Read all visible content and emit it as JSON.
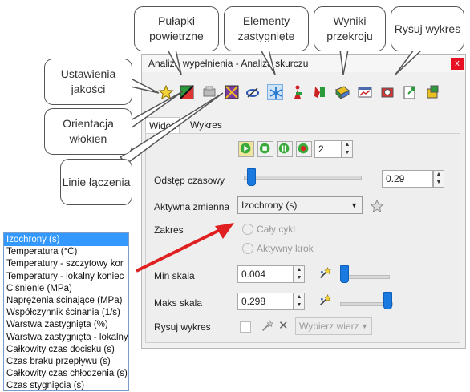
{
  "window": {
    "title": "Analiza wypełnienia - Analiza skurczu",
    "close": "x"
  },
  "callouts": {
    "pulapki": "Pułapki powietrzne",
    "elementy": "Elementy zastygnięte",
    "wyniki": "Wyniki przekroju",
    "rysuj": "Rysuj wykres",
    "ustawienia": "Ustawienia jakości",
    "orientacja": "Orientacja włókien",
    "linie": "Linie łączenia"
  },
  "tabs": {
    "widok": "Widok",
    "wykres": "Wykres"
  },
  "playback": {
    "frame": "2"
  },
  "odstep": {
    "label": "Odstęp czasowy",
    "value": "0.29",
    "slider_fraction": 0.03
  },
  "aktywna": {
    "label": "Aktywna zmienna",
    "value": "Izochrony (s)"
  },
  "zakres": {
    "label": "Zakres",
    "opt1": "Cały cykl",
    "opt2": "Aktywny krok"
  },
  "min": {
    "label": "Min skala",
    "value": "0.004",
    "slider_fraction": 0.0
  },
  "max": {
    "label": "Maks skala",
    "value": "0.298",
    "slider_fraction": 0.98
  },
  "rysuj": {
    "label": "Rysuj wykres",
    "select": "Wybierz wierz"
  },
  "dropdown_items": [
    "Izochrony (s)",
    "Temperatura (°C)",
    "Temperatury - szczytowy kor",
    "Temperatury - lokalny koniec",
    "Ciśnienie (MPa)",
    "Naprężenia ścinające (MPa)",
    "Współczynnik ścinania (1/s)",
    "Warstwa zastygnięta (%)",
    "Warstwa zastygnięta - lokalny",
    "Całkowity czas docisku (s)",
    "Czas braku przepływu (s)",
    "Całkowity czas chłodzenia (s)",
    "Czas stygnięcia (s)"
  ],
  "colors": {
    "accent": "#1a7ae0",
    "selection": "#3399ff",
    "arrow": "#e02020"
  }
}
